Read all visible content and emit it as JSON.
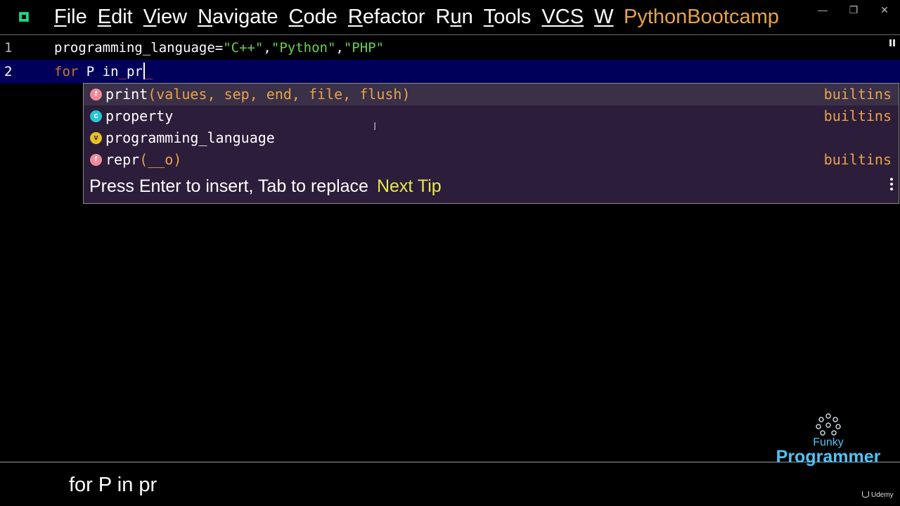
{
  "menu": {
    "items": [
      {
        "mnemonic": "F",
        "rest": "ile"
      },
      {
        "mnemonic": "E",
        "rest": "dit"
      },
      {
        "mnemonic": "V",
        "rest": "iew"
      },
      {
        "mnemonic": "N",
        "rest": "avigate"
      },
      {
        "mnemonic": "C",
        "rest": "ode"
      },
      {
        "mnemonic": "R",
        "rest": "efactor"
      },
      {
        "pre": "R",
        "mnemonic": "u",
        "rest": "n"
      },
      {
        "mnemonic": "T",
        "rest": "ools"
      },
      {
        "mnemonic": "VCS",
        "rest": ""
      },
      {
        "mnemonic": "W",
        "rest": ""
      }
    ],
    "project": "PythonBootcamp"
  },
  "window_controls": {
    "minimize": "—",
    "restore": "❐",
    "close": "✕"
  },
  "editor": {
    "line1": {
      "number": "1",
      "var": "programming_language=",
      "s1": "\"C++\"",
      "c1": ",",
      "s2": "\"Python\"",
      "c2": ",",
      "s3": "\"PHP\""
    },
    "line2": {
      "number": "2",
      "kw": "for",
      "rest": " P in",
      "typed": "pr"
    }
  },
  "completion": {
    "items": [
      {
        "kind": "f",
        "match": "pr",
        "rest": "int",
        "params": "(values, sep, end, file, flush)",
        "origin": "builtins"
      },
      {
        "kind": "c",
        "match": "pr",
        "rest": "operty",
        "params": "",
        "origin": "builtins"
      },
      {
        "kind": "v",
        "match": "pr",
        "rest": "ogramming_language",
        "params": "",
        "origin": ""
      },
      {
        "kind": "f",
        "pre": "re",
        "match": "pr",
        "rest": "",
        "params": "(__o)",
        "origin": "builtins"
      }
    ],
    "tip_text": "Press Enter to insert, Tab to replace",
    "next_tip": "Next Tip"
  },
  "caption": "for P in pr",
  "watermark": {
    "brand_top": "Funky",
    "brand_main": "Programmer",
    "udemy": "Udemy"
  },
  "colors": {
    "project_title": "#e8a349",
    "string": "#6ad04c",
    "keyword": "#cc7832",
    "popup_bg": "#2c1d3a",
    "current_line": "#00005a",
    "next_tip": "#e8e84a",
    "brand": "#4fc3f7"
  }
}
